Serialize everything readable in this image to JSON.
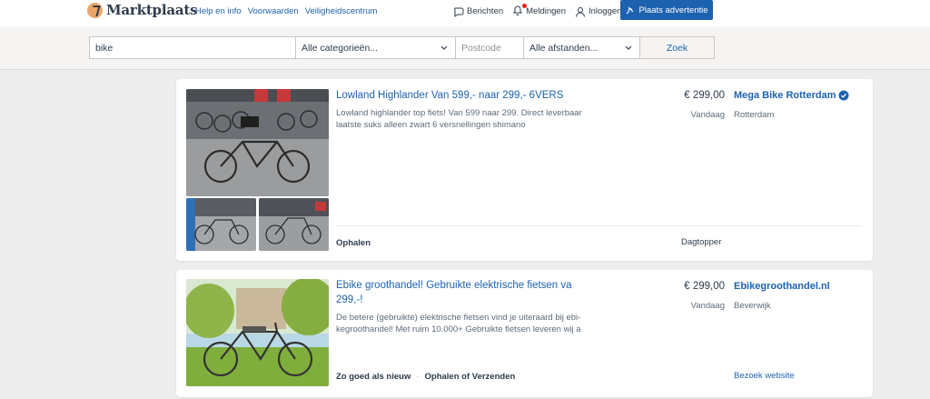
{
  "header": {
    "logo_text": "Marktplaats",
    "links": [
      "Help en info",
      "Voorwaarden",
      "Veiligheidscentrum"
    ],
    "berichten": "Berichten",
    "meldingen": "Meldingen",
    "inloggen": "Inloggen",
    "place_ad": "Plaats advertentie",
    "accent_color": "#1d62af"
  },
  "search": {
    "query": "bike",
    "category": "Alle categorieën...",
    "postcode_placeholder": "Postcode",
    "distance": "Alle afstanden...",
    "submit": "Zoek"
  },
  "listings": [
    {
      "title": "Lowland Highlander Van 599,- naar 299,- 6VERS",
      "description": "Lowland highlander top fiets! Van 599 naar 299. Direct leverbaar laatste suks alleen zwart 6 versnellingen shimano",
      "price": "€ 299,00",
      "date": "Vandaag",
      "seller": "Mega Bike Rotterdam",
      "verified": true,
      "location": "Rotterdam",
      "delivery": "Ophalen",
      "badge": "Dagtopper"
    },
    {
      "title": "Ebike groothandel! Gebruikte elektrische fietsen va 299,-!",
      "description": "De betere (gebruikte) elektrische fietsen vind je uiteraard bij ebi-kegroothandel! Met ruim 10.000+ Gebruikte fietsen leveren wij a",
      "price": "€ 299,00",
      "date": "Vandaag",
      "seller": "Ebikegroothandel.nl",
      "location": "Beverwijk",
      "condition": "Zo goed als nieuw",
      "delivery": "Ophalen of Verzenden",
      "link": "Bezoek website"
    }
  ]
}
